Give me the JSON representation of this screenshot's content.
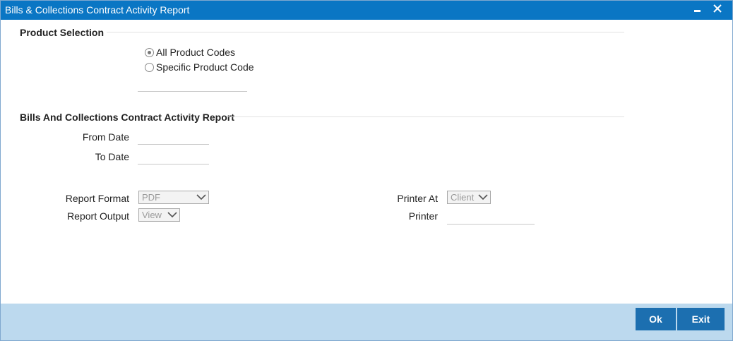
{
  "window": {
    "title": "Bills & Collections Contract Activity Report"
  },
  "product_selection": {
    "heading": "Product Selection",
    "options": [
      {
        "label": "All Product Codes",
        "checked": true
      },
      {
        "label": "Specific Product Code",
        "checked": false
      }
    ],
    "product_code_value": ""
  },
  "report_section": {
    "heading": "Bills And Collections Contract Activity Report",
    "from_date_label": "From Date",
    "from_date_value": "",
    "to_date_label": "To Date",
    "to_date_value": ""
  },
  "output": {
    "report_format_label": "Report Format",
    "report_format_value": "PDF",
    "report_output_label": "Report Output",
    "report_output_value": "View",
    "printer_at_label": "Printer At",
    "printer_at_value": "Client",
    "printer_label": "Printer",
    "printer_value": ""
  },
  "footer": {
    "ok_label": "Ok",
    "exit_label": "Exit"
  },
  "colors": {
    "titlebar": "#0a76c4",
    "footer": "#bcd9ee",
    "button": "#1c6fb0"
  },
  "icons": {
    "minimize": "minimize-icon",
    "close": "close-icon",
    "dropdown": "chevron-down-icon"
  }
}
